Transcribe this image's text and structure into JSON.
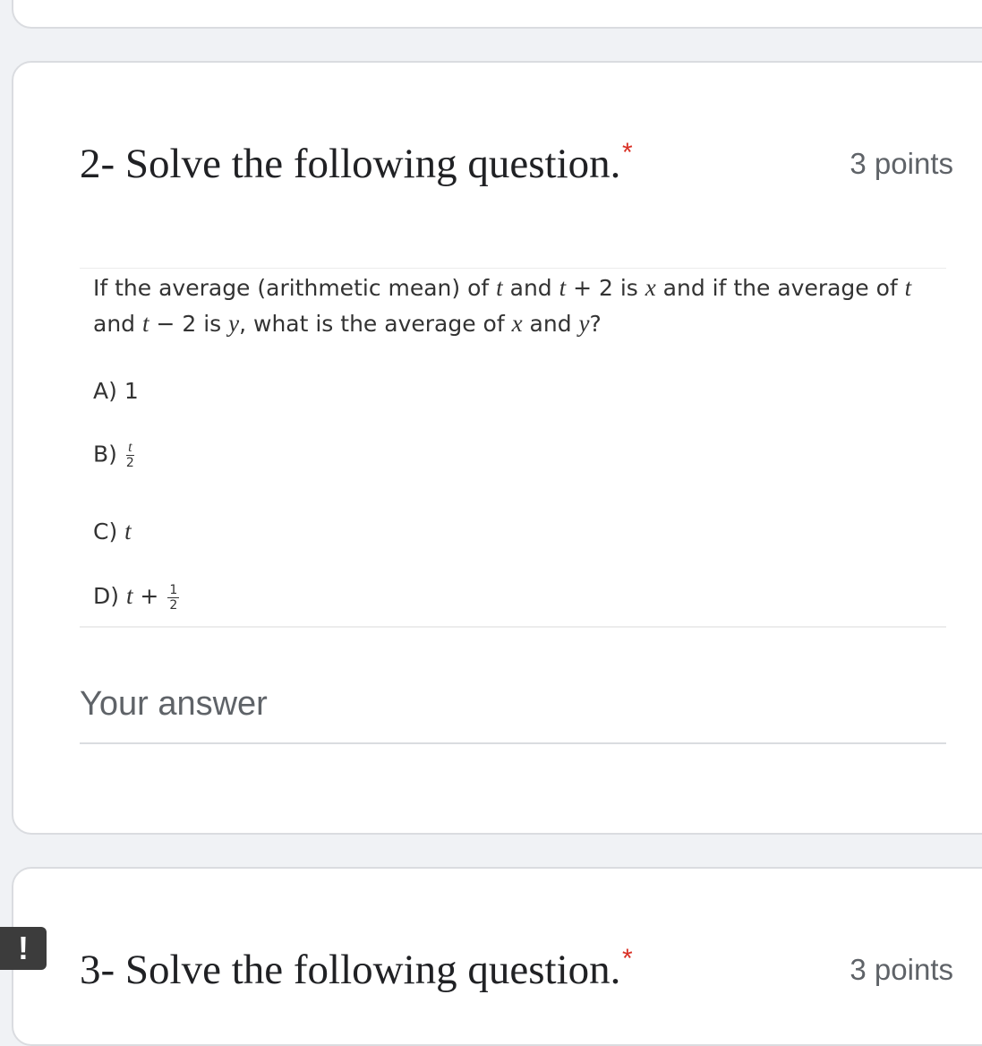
{
  "questions": [
    {
      "title": "2- Solve the following question.",
      "required_marker": "*",
      "points": "3 points",
      "problem": {
        "line1": {
          "a": "If the average (arithmetic mean) of ",
          "v1": "t",
          "b": " and ",
          "v2": "t",
          "c": " + 2 is ",
          "v3": "x",
          "d": " and if the average of ",
          "v4": "t"
        },
        "line2": {
          "a": "and ",
          "v1": "t",
          "b": " − 2 is ",
          "v2": "y",
          "c": ", what is the average of ",
          "v3": "x",
          "d": " and ",
          "v4": "y",
          "e": "?"
        },
        "options": {
          "A": {
            "label": "A) ",
            "text": "1"
          },
          "B": {
            "label": "B) ",
            "num": "t",
            "den": "2"
          },
          "C": {
            "label": "C) ",
            "var": "t"
          },
          "D": {
            "label": "D) ",
            "var": "t",
            "plus": " + ",
            "num": "1",
            "den": "2"
          }
        }
      },
      "answer_placeholder": "Your answer"
    },
    {
      "title": "3- Solve the following question.",
      "required_marker": "*",
      "points": "3 points"
    }
  ],
  "report_button": "!",
  "colors": {
    "background": "#f0f2f5",
    "card": "#ffffff",
    "required": "#d93025",
    "muted_text": "#5f6368"
  }
}
